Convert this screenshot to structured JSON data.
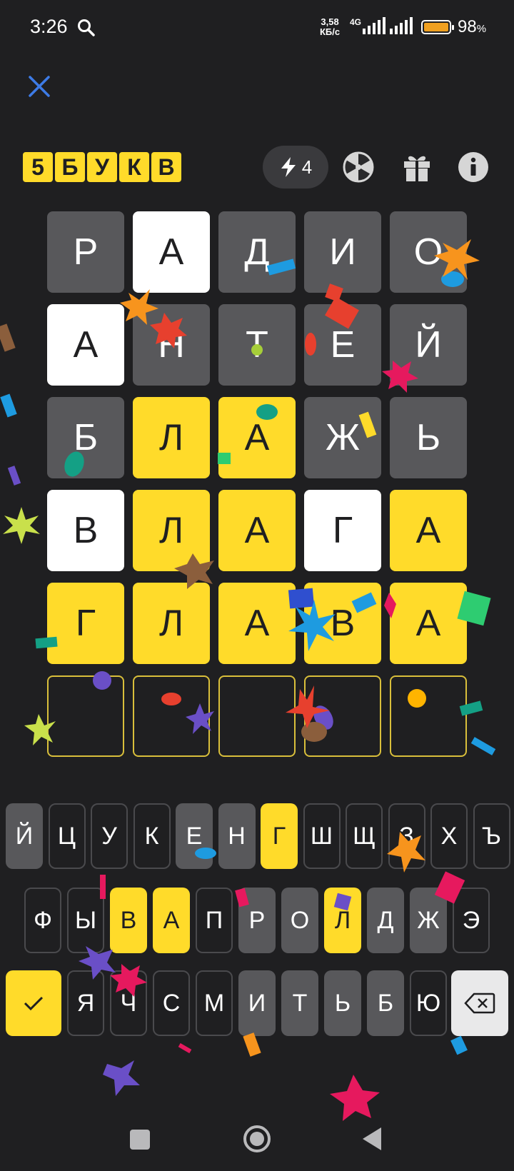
{
  "status_bar": {
    "time": "3:26",
    "net_speed_value": "3,58",
    "net_speed_unit": "КБ/с",
    "network_type": "4G",
    "battery": "98",
    "battery_unit": "%",
    "battery_color": "#f0a020"
  },
  "header": {
    "logo_letters": [
      "5",
      "Б",
      "У",
      "К",
      "В"
    ],
    "hints_count": "4",
    "icons": [
      "bolt-icon",
      "wheel-icon",
      "gift-icon",
      "info-icon"
    ]
  },
  "colors": {
    "background": "#1f1f21",
    "absent": "#58585b",
    "present": "#ffffff",
    "correct": "#ffdb2a"
  },
  "board": {
    "rows": [
      [
        {
          "l": "Р",
          "s": "gray"
        },
        {
          "l": "А",
          "s": "white"
        },
        {
          "l": "Д",
          "s": "gray"
        },
        {
          "l": "И",
          "s": "gray"
        },
        {
          "l": "О",
          "s": "gray"
        }
      ],
      [
        {
          "l": "А",
          "s": "white"
        },
        {
          "l": "Н",
          "s": "gray"
        },
        {
          "l": "Т",
          "s": "gray"
        },
        {
          "l": "Е",
          "s": "gray"
        },
        {
          "l": "Й",
          "s": "gray"
        }
      ],
      [
        {
          "l": "Б",
          "s": "gray"
        },
        {
          "l": "Л",
          "s": "yellow"
        },
        {
          "l": "А",
          "s": "yellow"
        },
        {
          "l": "Ж",
          "s": "gray"
        },
        {
          "l": "Ь",
          "s": "gray"
        }
      ],
      [
        {
          "l": "В",
          "s": "white"
        },
        {
          "l": "Л",
          "s": "yellow"
        },
        {
          "l": "А",
          "s": "yellow"
        },
        {
          "l": "Г",
          "s": "white"
        },
        {
          "l": "А",
          "s": "yellow"
        }
      ],
      [
        {
          "l": "Г",
          "s": "yellow"
        },
        {
          "l": "Л",
          "s": "yellow"
        },
        {
          "l": "А",
          "s": "yellow"
        },
        {
          "l": "В",
          "s": "yellow"
        },
        {
          "l": "А",
          "s": "yellow"
        }
      ],
      [
        {
          "l": "",
          "s": "empty"
        },
        {
          "l": "",
          "s": "empty"
        },
        {
          "l": "",
          "s": "empty"
        },
        {
          "l": "",
          "s": "empty"
        },
        {
          "l": "",
          "s": "empty"
        }
      ]
    ]
  },
  "keyboard": {
    "row1": [
      {
        "k": "Й",
        "s": "absent"
      },
      {
        "k": "Ц",
        "s": "unused"
      },
      {
        "k": "У",
        "s": "unused"
      },
      {
        "k": "К",
        "s": "unused"
      },
      {
        "k": "Е",
        "s": "absent"
      },
      {
        "k": "Н",
        "s": "absent"
      },
      {
        "k": "Г",
        "s": "present"
      },
      {
        "k": "Ш",
        "s": "unused"
      },
      {
        "k": "Щ",
        "s": "unused"
      },
      {
        "k": "З",
        "s": "unused"
      },
      {
        "k": "Х",
        "s": "unused"
      },
      {
        "k": "Ъ",
        "s": "unused"
      }
    ],
    "row2": [
      {
        "k": "Ф",
        "s": "unused"
      },
      {
        "k": "Ы",
        "s": "unused"
      },
      {
        "k": "В",
        "s": "present"
      },
      {
        "k": "А",
        "s": "present"
      },
      {
        "k": "П",
        "s": "unused"
      },
      {
        "k": "Р",
        "s": "absent"
      },
      {
        "k": "О",
        "s": "absent"
      },
      {
        "k": "Л",
        "s": "present"
      },
      {
        "k": "Д",
        "s": "absent"
      },
      {
        "k": "Ж",
        "s": "absent"
      },
      {
        "k": "Э",
        "s": "unused"
      }
    ],
    "row3": [
      {
        "k": "Я",
        "s": "unused"
      },
      {
        "k": "Ч",
        "s": "unused"
      },
      {
        "k": "С",
        "s": "unused"
      },
      {
        "k": "М",
        "s": "unused"
      },
      {
        "k": "И",
        "s": "absent"
      },
      {
        "k": "Т",
        "s": "absent"
      },
      {
        "k": "Ь",
        "s": "absent"
      },
      {
        "k": "Б",
        "s": "absent"
      },
      {
        "k": "Ю",
        "s": "unused"
      }
    ],
    "enter_icon": "check-icon",
    "backspace_icon": "backspace-icon"
  },
  "nav_bar": {
    "icons": [
      "recents-square-icon",
      "home-circle-icon",
      "back-triangle-icon"
    ]
  }
}
